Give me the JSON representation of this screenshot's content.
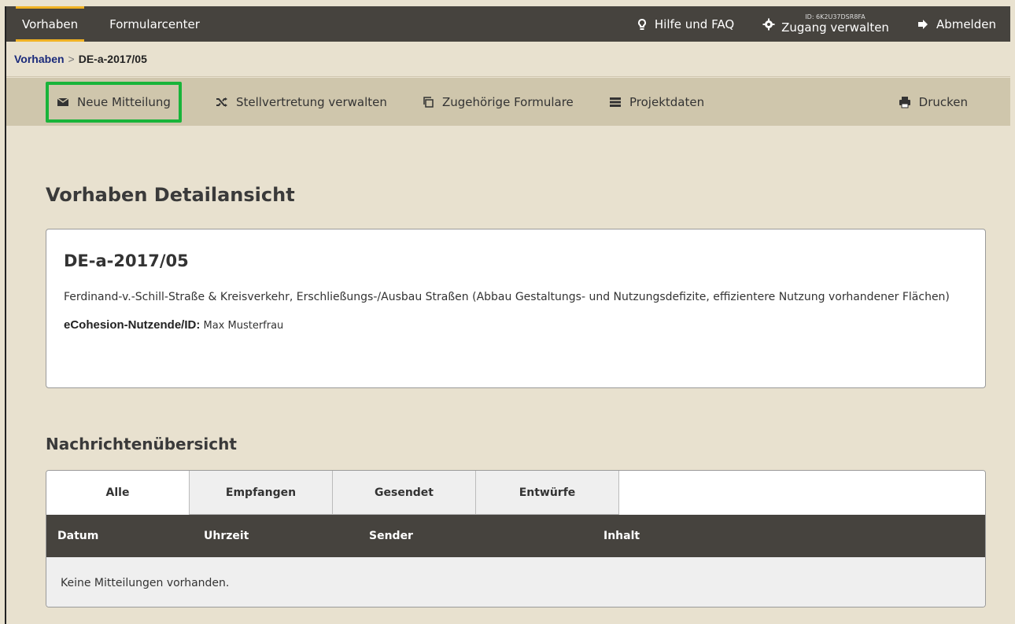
{
  "topbar": {
    "tabs": [
      {
        "label": "Vorhaben",
        "active": true
      },
      {
        "label": "Formularcenter",
        "active": false
      }
    ],
    "help_label": "Hilfe und FAQ",
    "account_id": "ID: 6K2U37DSR8FA",
    "account_label": "Zugang verwalten",
    "logout_label": "Abmelden",
    "accent_color": "#f0b224"
  },
  "breadcrumb": {
    "root": "Vorhaben",
    "separator": ">",
    "current": "DE-a-2017/05"
  },
  "toolbar": {
    "new_message": "Neue Mitteilung",
    "deputy": "Stellvertretung verwalten",
    "forms": "Zugehörige Formulare",
    "project_data": "Projektdaten",
    "print": "Drucken",
    "highlight_color": "#19b43a"
  },
  "main": {
    "title": "Vorhaben Detailansicht",
    "card": {
      "code": "DE-a-2017/05",
      "description": "Ferdinand-v.-Schill-Straße & Kreisverkehr, Erschließungs-/Ausbau Straßen (Abbau Gestaltungs- und Nutzungsdefizite, effizientere Nutzung vorhandener Flächen)",
      "user_label": "eCohesion-Nutzende/ID:",
      "user_value": "Max Musterfrau"
    },
    "messages": {
      "title": "Nachrichtenübersicht",
      "tabs": [
        "Alle",
        "Empfangen",
        "Gesendet",
        "Entwürfe"
      ],
      "columns": [
        "Datum",
        "Uhrzeit",
        "Sender",
        "Inhalt"
      ],
      "empty_text": "Keine Mitteilungen vorhanden."
    }
  }
}
